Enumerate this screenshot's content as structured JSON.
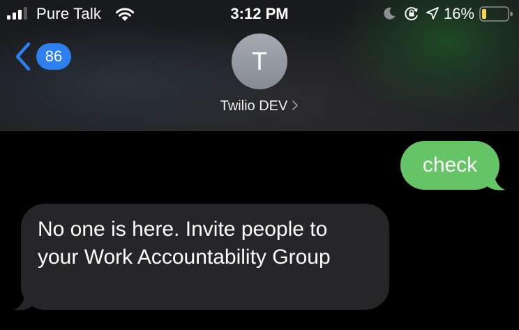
{
  "status_bar": {
    "carrier": "Pure Talk",
    "time": "3:12 PM",
    "battery_percent": "16%",
    "icons": [
      "signal-bars-icon",
      "wifi-icon",
      "moon-icon",
      "rotation-lock-icon",
      "location-arrow-icon",
      "battery-icon"
    ],
    "battery_level": 0.16,
    "signal_bars": 3
  },
  "nav": {
    "unread_count": "86",
    "back_icon": "chevron-left-icon",
    "avatar_initial": "T",
    "contact_name": "Twilio DEV",
    "contact_chevron": "›"
  },
  "messages": [
    {
      "direction": "sent",
      "text": "check"
    },
    {
      "direction": "received",
      "text": "No one is here. Invite people to your Work Accountability Group"
    }
  ],
  "colors": {
    "sent_bubble": "#65c466",
    "received_bubble": "#262628",
    "badge": "#2d7ff0",
    "back_chevron": "#2d7ff0",
    "battery_fill": "#f6d64a"
  }
}
